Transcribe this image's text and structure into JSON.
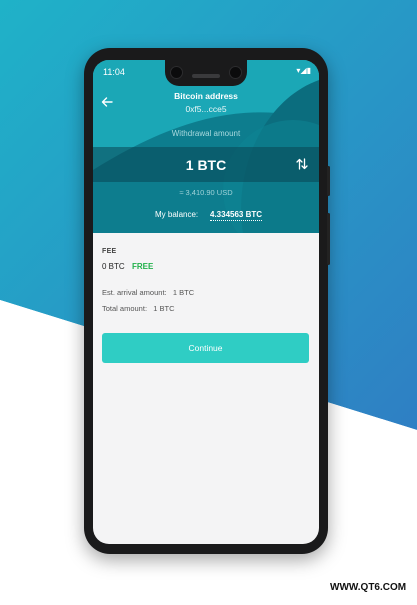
{
  "status_bar": {
    "time": "11:04",
    "icons": "▾◢▮"
  },
  "header": {
    "title": "Bitcoin address",
    "address": "0xf5...cce5"
  },
  "withdrawal": {
    "label": "Withdrawal amount",
    "amount": "1 BTC",
    "usd_equivalent": "≈ 3,410.90 USD",
    "balance_label": "My balance:",
    "balance_value": "4.334563 BTC"
  },
  "fee": {
    "label": "FEE",
    "value": "0 BTC",
    "badge": "FREE",
    "est_arrival": "Est. arrival amount:   1 BTC",
    "total": "Total amount:   1 BTC"
  },
  "actions": {
    "continue_label": "Continue"
  },
  "watermark": "WWW.QT6.COM",
  "colors": {
    "accent": "#2fcdc4",
    "free_green": "#21b14a",
    "hero_teal": "#0d7d8e",
    "backdrop_blue": "#2a8bc4"
  }
}
